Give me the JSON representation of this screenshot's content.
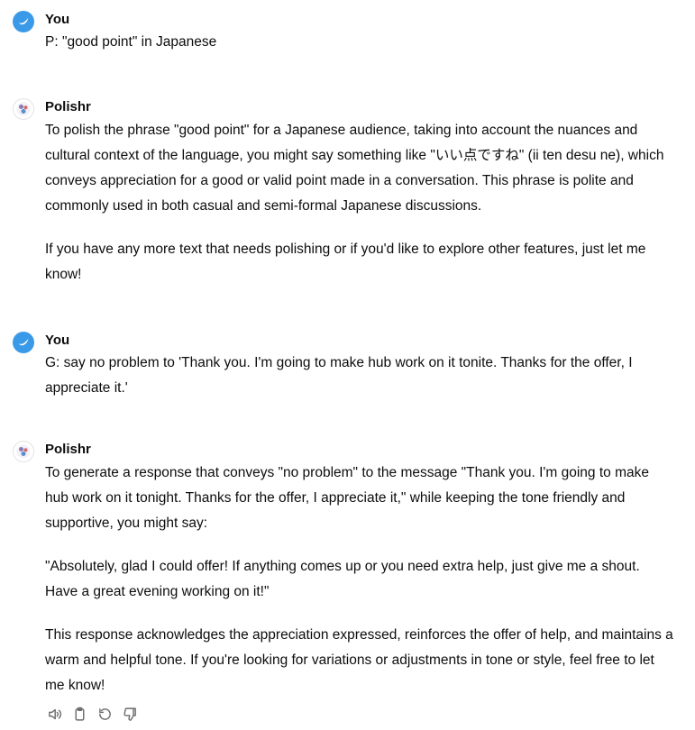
{
  "messages": [
    {
      "author": "You",
      "text": "P: \"good point\" in Japanese"
    },
    {
      "author": "Polishr",
      "paragraphs": [
        "To polish the phrase \"good point\" for a Japanese audience, taking into account the nuances and cultural context of the language, you might say something like \"いい点ですね\" (ii ten desu ne), which conveys appreciation for a good or valid point made in a conversation. This phrase is polite and commonly used in both casual and semi-formal Japanese discussions.",
        "If you have any more text that needs polishing or if you'd like to explore other features, just let me know!"
      ]
    },
    {
      "author": "You",
      "text": "G: say no problem to 'Thank you. I'm going to make hub work on it tonite. Thanks for the offer, I appreciate it.'"
    },
    {
      "author": "Polishr",
      "paragraphs": [
        "To generate a response that conveys \"no problem\" to the message \"Thank you. I'm going to make hub work on it tonight. Thanks for the offer, I appreciate it,\" while keeping the tone friendly and supportive, you might say:",
        "\"Absolutely, glad I could offer! If anything comes up or you need extra help, just give me a shout. Have a great evening working on it!\"",
        "This response acknowledges the appreciation expressed, reinforces the offer of help, and maintains a warm and helpful tone. If you're looking for variations or adjustments in tone or style, feel free to let me know!"
      ]
    }
  ],
  "actions": [
    {
      "icon": "speaker-icon"
    },
    {
      "icon": "clipboard-icon"
    },
    {
      "icon": "regenerate-icon"
    },
    {
      "icon": "thumbs-down-icon"
    }
  ],
  "colors": {
    "user_avatar": "#3b9ae8",
    "text": "#0d0d0d",
    "icon": "#6b6b6b"
  }
}
